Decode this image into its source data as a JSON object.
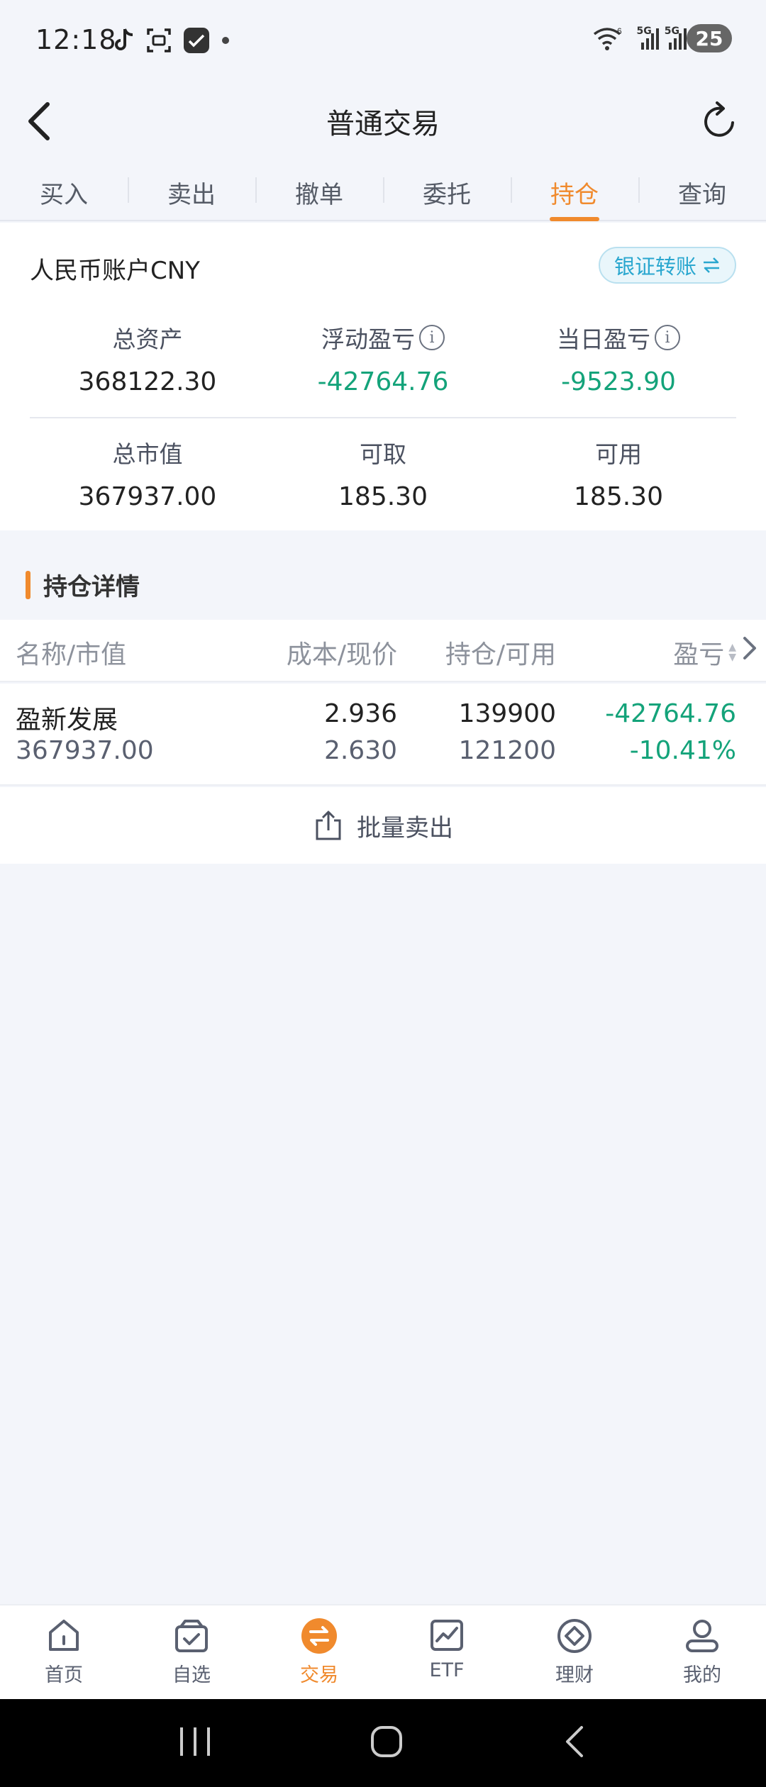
{
  "status_bar": {
    "time": "12:18",
    "battery": "25",
    "net1": "5G",
    "net2": "5G",
    "wifi_badge": "6"
  },
  "header": {
    "title": "普通交易"
  },
  "tabs": [
    {
      "label": "买入"
    },
    {
      "label": "卖出"
    },
    {
      "label": "撤单"
    },
    {
      "label": "委托"
    },
    {
      "label": "持仓"
    },
    {
      "label": "查询"
    }
  ],
  "account": {
    "name": "人民币账户CNY",
    "transfer_label": "银证转账",
    "total_assets_label": "总资产",
    "total_assets": "368122.30",
    "floating_pl_label": "浮动盈亏",
    "floating_pl": "-42764.76",
    "daily_pl_label": "当日盈亏",
    "daily_pl": "-9523.90",
    "market_value_label": "总市值",
    "market_value": "367937.00",
    "withdrawable_label": "可取",
    "withdrawable": "185.30",
    "available_label": "可用",
    "available": "185.30"
  },
  "holdings": {
    "section_title": "持仓详情",
    "headers": {
      "name": "名称/市值",
      "cost": "成本/现价",
      "hold": "持仓/可用",
      "pl": "盈亏"
    },
    "rows": [
      {
        "name": "盈新发展",
        "market_value": "367937.00",
        "cost": "2.936",
        "price": "2.630",
        "position": "139900",
        "available": "121200",
        "pl": "-42764.76",
        "pl_pct": "-10.41%"
      }
    ],
    "batch_sell_label": "批量卖出"
  },
  "bottom_nav": [
    {
      "label": "首页",
      "icon": "home-icon"
    },
    {
      "label": "自选",
      "icon": "watchlist-icon"
    },
    {
      "label": "交易",
      "icon": "trade-icon"
    },
    {
      "label": "ETF",
      "icon": "etf-icon"
    },
    {
      "label": "理财",
      "icon": "wealth-icon"
    },
    {
      "label": "我的",
      "icon": "profile-icon"
    }
  ],
  "colors": {
    "accent": "#f08a2d",
    "loss_green": "#14a37a",
    "transfer_blue": "#2aa7cf"
  }
}
